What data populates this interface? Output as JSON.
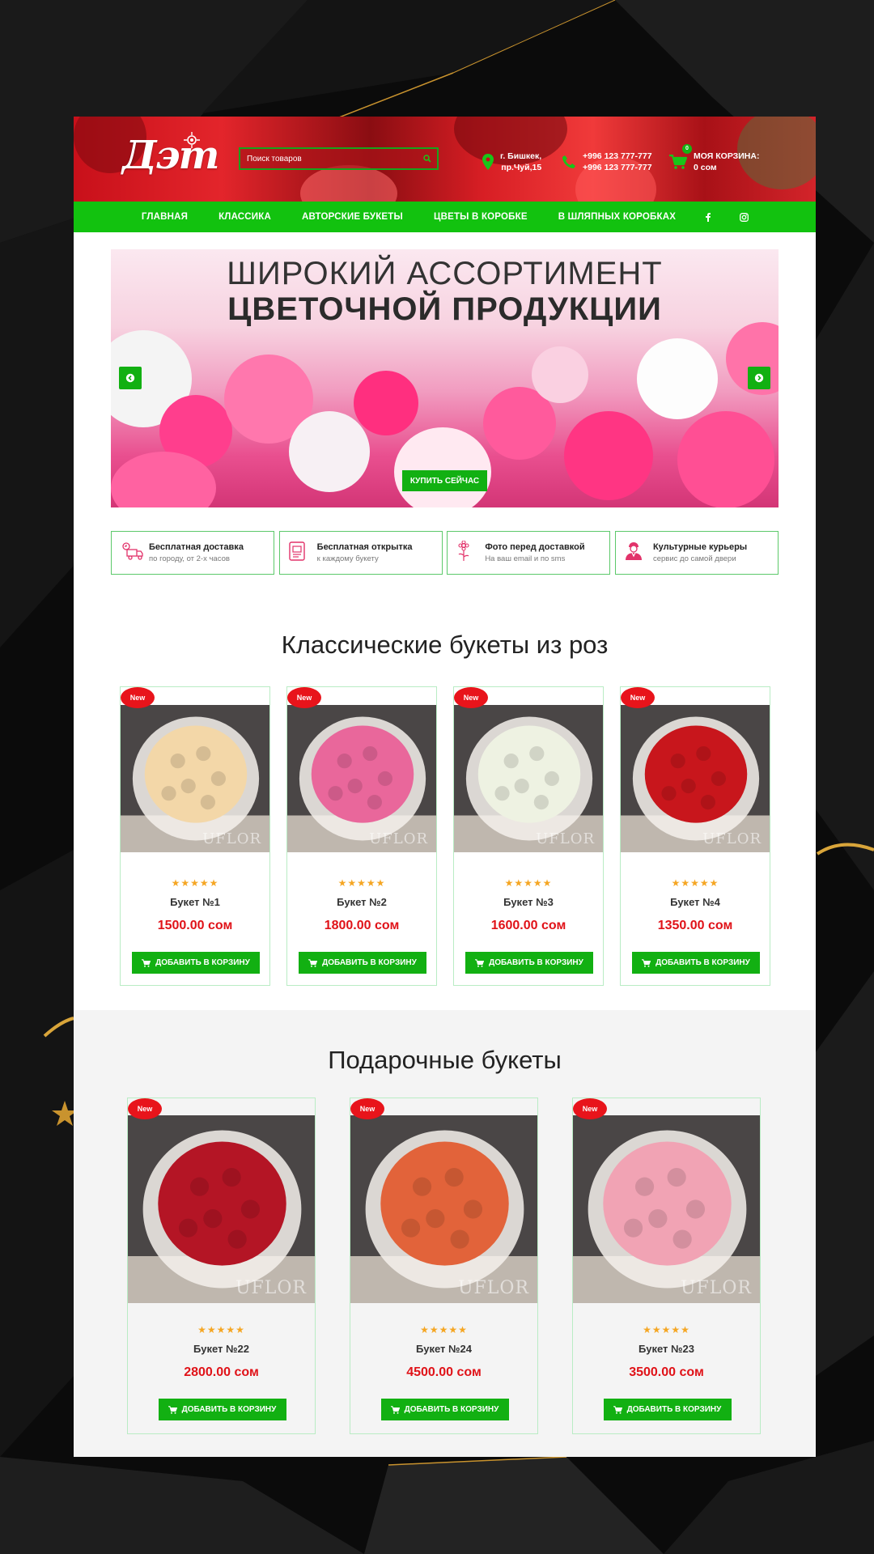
{
  "brand": {
    "logo_text": "Дэт"
  },
  "search": {
    "placeholder": "Поиск товаров"
  },
  "contacts": {
    "address_line1": "г. Бишкек,",
    "address_line2": "пр.Чуй,15",
    "phone1": "+996 123 777-777",
    "phone2": "+996 123 777-777"
  },
  "cart": {
    "label": "МОЯ КОРЗИНА:",
    "total": "0 сом",
    "count": "0"
  },
  "nav": {
    "items": [
      "ГЛАВНАЯ",
      "КЛАССИКА",
      "АВТОРСКИЕ БУКЕТЫ",
      "ЦВЕТЫ В КОРОБКЕ",
      "В ШЛЯПНЫХ КОРОБКАХ"
    ],
    "social": [
      "facebook-icon",
      "instagram-icon"
    ]
  },
  "hero": {
    "line1": "ШИРОКИЙ АССОРТИМЕНТ",
    "line2": "ЦВЕТОЧНОЙ ПРОДУКЦИИ",
    "button": "КУПИТЬ СЕЙЧАС"
  },
  "features": [
    {
      "icon": "delivery-truck-icon",
      "title": "Бесплатная доставка",
      "sub": "по городу, от 2-х часов"
    },
    {
      "icon": "card-icon",
      "title": "Бесплатная открытка",
      "sub": "к каждому букету"
    },
    {
      "icon": "flower-icon",
      "title": "Фото перед доставкой",
      "sub": "На ваш email и по sms"
    },
    {
      "icon": "courier-icon",
      "title": "Культурные курьеры",
      "sub": "сервис до самой двери"
    }
  ],
  "classic": {
    "title": "Классические букеты из роз",
    "products": [
      {
        "badge": "New",
        "name": "Букет №1",
        "price": "1500.00 сом",
        "rating": 5,
        "color": "#f3d7a8",
        "button": "ДОБАВИТЬ В КОРЗИНУ"
      },
      {
        "badge": "New",
        "name": "Букет №2",
        "price": "1800.00 сом",
        "rating": 5,
        "color": "#e9679b",
        "button": "ДОБАВИТЬ В КОРЗИНУ"
      },
      {
        "badge": "New",
        "name": "Букет №3",
        "price": "1600.00 сом",
        "rating": 5,
        "color": "#eef2e2",
        "button": "ДОБАВИТЬ В КОРЗИНУ"
      },
      {
        "badge": "New",
        "name": "Букет №4",
        "price": "1350.00 сом",
        "rating": 5,
        "color": "#c8161c",
        "button": "ДОБАВИТЬ В КОРЗИНУ"
      }
    ]
  },
  "gift": {
    "title": "Подарочные букеты",
    "products": [
      {
        "badge": "New",
        "name": "Букет №22",
        "price": "2800.00 сом",
        "rating": 5,
        "color": "#b41525",
        "button": "ДОБАВИТЬ В КОРЗИНУ"
      },
      {
        "badge": "New",
        "name": "Букет №24",
        "price": "4500.00 сом",
        "rating": 5,
        "color": "#e2633a",
        "button": "ДОБАВИТЬ В КОРЗИНУ"
      },
      {
        "badge": "New",
        "name": "Букет №23",
        "price": "3500.00 сом",
        "rating": 5,
        "color": "#f1a3b4",
        "button": "ДОБАВИТЬ В КОРЗИНУ"
      }
    ]
  },
  "watermark": "UFLOR",
  "colors": {
    "accent_green": "#12c20f",
    "price_red": "#e01218",
    "badge_red": "#e8141b",
    "star": "#f5a623"
  }
}
